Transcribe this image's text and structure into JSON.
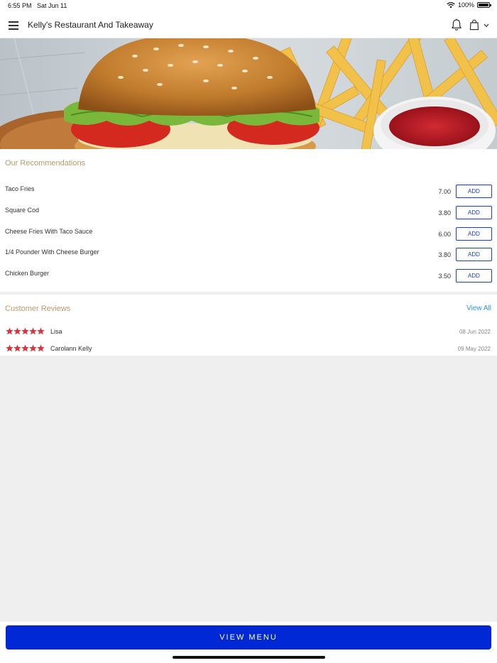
{
  "status_bar": {
    "time": "6:55 PM",
    "date": "Sat Jun 11",
    "battery": "100%"
  },
  "header": {
    "title": "Kelly's Restaurant And Takeaway",
    "icons": [
      "menu-icon",
      "bell-icon",
      "shopping-bag-icon",
      "chevron-down-icon"
    ]
  },
  "hero": {
    "image": "burger-and-fries-photo"
  },
  "recommendations": {
    "title": "Our Recommendations",
    "add_label": "ADD",
    "items": [
      {
        "name": "Taco Fries",
        "price": "7.00"
      },
      {
        "name": "Square Cod",
        "price": "3.80"
      },
      {
        "name": "Cheese Fries With Taco Sauce",
        "price": "6.00"
      },
      {
        "name": "1/4 Pounder With Cheese Burger",
        "price": "3.80"
      },
      {
        "name": "Chicken Burger",
        "price": "3.50"
      }
    ]
  },
  "reviews": {
    "title": "Customer Reviews",
    "view_all": "View All",
    "items": [
      {
        "name": "Lisa",
        "date": "08 Jun 2022",
        "rating": 5
      },
      {
        "name": "Carolann Kelly",
        "date": "09 May 2022",
        "rating": 5
      }
    ]
  },
  "bottom": {
    "view_menu": "VIEW MENU"
  },
  "colors": {
    "accent_blue": "#0028d4",
    "section_title": "#b89a70",
    "link": "#2a9ad0",
    "star": "#d9343a"
  }
}
